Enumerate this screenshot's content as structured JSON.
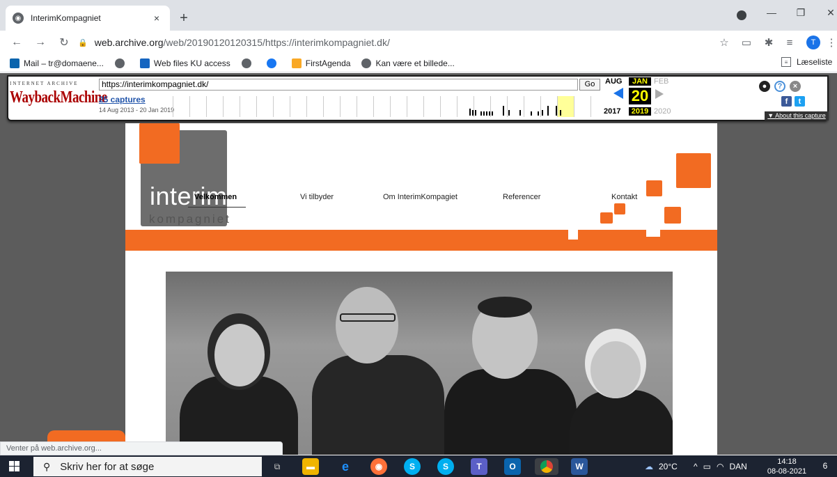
{
  "browser": {
    "tab_title": "InterimKompagniet",
    "tab_close": "×",
    "new_tab": "+",
    "url_host": "web.archive.org",
    "url_path": "/web/20190120120315/https://interimkompagniet.dk/",
    "avatar_letter": "T"
  },
  "bookmarks": [
    {
      "label": "Mail – tr@domaene...",
      "icon": "outlook-icon",
      "color": "#0a64ad"
    },
    {
      "label": "",
      "icon": "globe-icon",
      "color": "#5f6368"
    },
    {
      "label": "Web files KU access",
      "icon": "ku-icon",
      "color": "#1565c0"
    },
    {
      "label": "",
      "icon": "globe-icon",
      "color": "#5f6368"
    },
    {
      "label": "",
      "icon": "facebook-icon",
      "color": "#1877f2"
    },
    {
      "label": "FirstAgenda",
      "icon": "firstagenda-icon",
      "color": "#f9a825"
    },
    {
      "label": "Kan være et billede...",
      "icon": "globe-icon",
      "color": "#5f6368"
    }
  ],
  "reading_list": "Læseliste",
  "wayback": {
    "logo_top": "INTERNET ARCHIVE",
    "logo": "WaybackMachine",
    "url_value": "https://interimkompagniet.dk/",
    "go": "Go",
    "captures": "25 captures",
    "range": "14 Aug 2013 - 20 Jan 2019",
    "month_prev": "AUG",
    "month_cur": "JAN",
    "month_next": "FEB",
    "day": "20",
    "year_prev": "2017",
    "year_cur": "2019",
    "year_next": "2020",
    "about": "▼ About this capture"
  },
  "site": {
    "logo_word": "interim",
    "logo_word2": "kompagniet",
    "nav": [
      "Velkommen",
      "Vi tilbyder",
      "Om InterimKompagiet",
      "Referencer",
      "Kontakt"
    ]
  },
  "status_text": "Venter på web.archive.org...",
  "taskbar": {
    "search_placeholder": "Skriv her for at søge",
    "temperature": "20°C",
    "language": "DAN",
    "time": "14:18",
    "date": "08-08-2021",
    "notification_count": "6"
  }
}
